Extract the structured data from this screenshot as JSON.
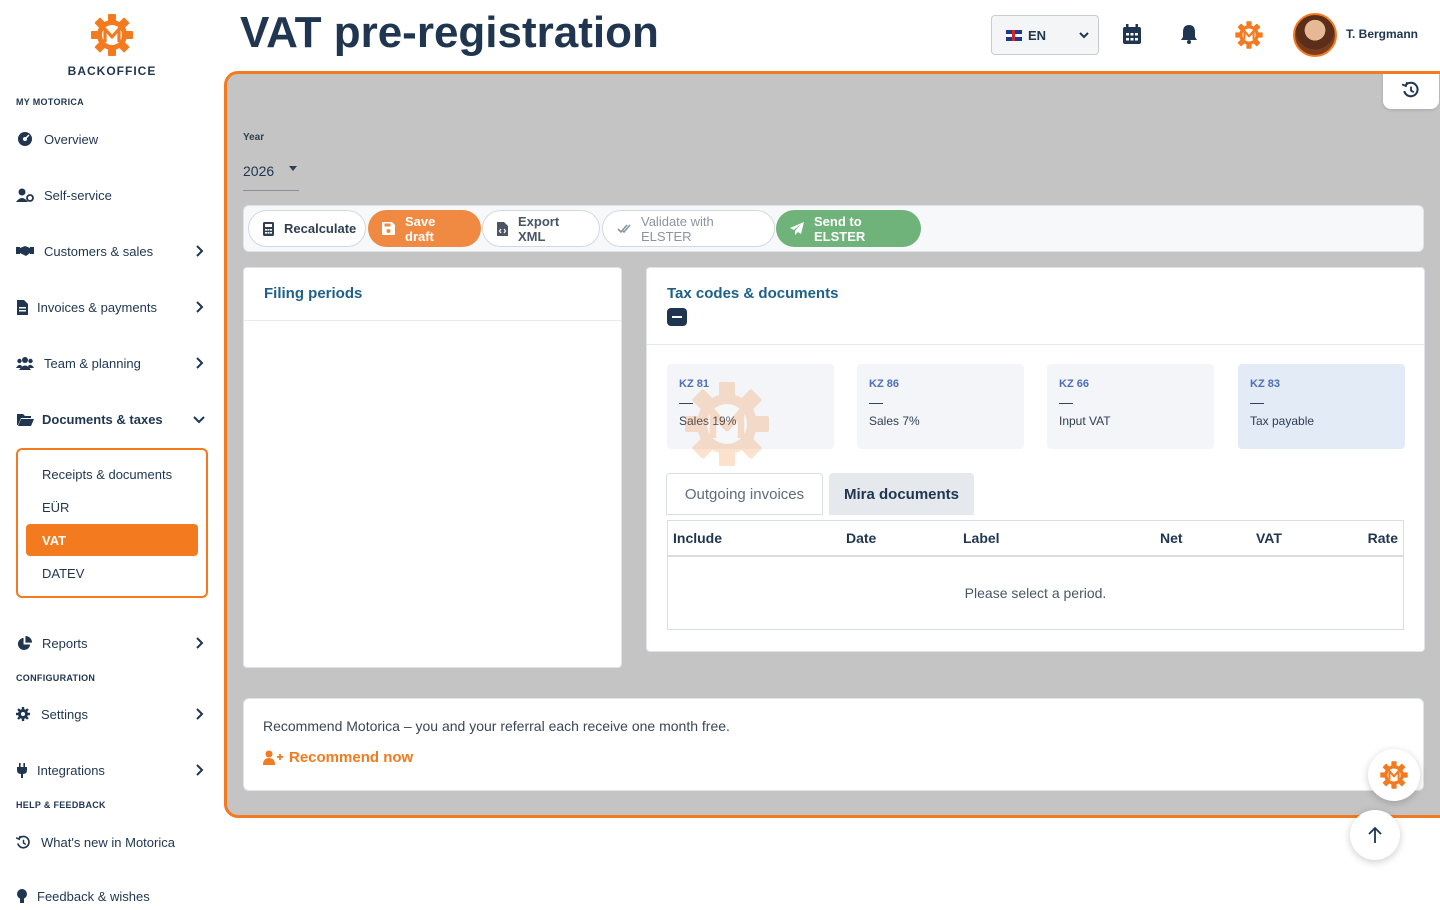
{
  "brand": {
    "name": "BACKOFFICE"
  },
  "page": {
    "title": "VAT pre-registration"
  },
  "topbar": {
    "language": "EN",
    "user_name": "T. Bergmann"
  },
  "sidebar": {
    "section_my": "MY MOTORICA",
    "section_config": "CONFIGURATION",
    "section_help": "HELP & FEEDBACK",
    "items": [
      {
        "label": "Overview"
      },
      {
        "label": "Self-service"
      },
      {
        "label": "Customers & sales"
      },
      {
        "label": "Invoices & payments"
      },
      {
        "label": "Team & planning"
      },
      {
        "label": "Documents & taxes"
      },
      {
        "label": "Reports"
      },
      {
        "label": "Settings"
      },
      {
        "label": "Integrations"
      },
      {
        "label": "What's new in Motorica"
      },
      {
        "label": "Feedback & wishes"
      }
    ],
    "sub_items": [
      {
        "label": "Receipts & documents"
      },
      {
        "label": "EÜR"
      },
      {
        "label": "VAT"
      },
      {
        "label": "DATEV"
      }
    ]
  },
  "year": {
    "label": "Year",
    "value": "2026"
  },
  "toolbar": {
    "recalculate": "Recalculate",
    "save_draft": "Save draft",
    "export_xml": "Export XML",
    "validate": "Validate with ELSTER",
    "send": "Send to ELSTER"
  },
  "filing_periods": {
    "title": "Filing periods"
  },
  "tax_codes": {
    "title": "Tax codes & documents",
    "boxes": [
      {
        "code": "KZ 81",
        "value": "—",
        "label": "Sales 19%"
      },
      {
        "code": "KZ 86",
        "value": "—",
        "label": "Sales 7%"
      },
      {
        "code": "KZ 66",
        "value": "—",
        "label": "Input VAT"
      },
      {
        "code": "KZ 83",
        "value": "—",
        "label": "Tax payable"
      }
    ],
    "tabs": [
      "Outgoing invoices",
      "Mira documents"
    ],
    "columns": [
      "Include",
      "Date",
      "Label",
      "Net",
      "VAT",
      "Rate"
    ],
    "empty_text": "Please select a period."
  },
  "recommend": {
    "text": "Recommend Motorica – you and your referral each receive one month free.",
    "link": "Recommend now"
  },
  "colors": {
    "accent": "#f47a1f",
    "navy": "#1f3550",
    "link_blue": "#1e5f8c",
    "success": "#6fb37b"
  }
}
